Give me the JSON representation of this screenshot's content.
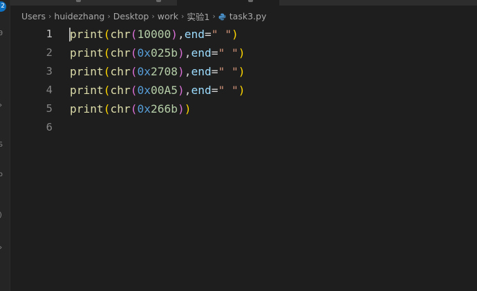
{
  "breadcrumb": {
    "segments": [
      "Users",
      "huidezhang",
      "Desktop",
      "work",
      "实验1"
    ],
    "file": "task3.py",
    "file_icon": "python-icon"
  },
  "sidebar": {
    "badge": "2",
    "glyphs": [
      "0",
      "›",
      "S",
      "o",
      ")",
      "›"
    ]
  },
  "editor": {
    "current_line": 1,
    "line_numbers": [
      "1",
      "2",
      "3",
      "4",
      "5",
      "6"
    ],
    "lines": [
      [
        [
          "fn",
          "print"
        ],
        [
          "p1",
          "("
        ],
        [
          "fn",
          "chr"
        ],
        [
          "p2",
          "("
        ],
        [
          "num",
          "10000"
        ],
        [
          "p2",
          ")"
        ],
        [
          "op",
          ","
        ],
        [
          "kw",
          "end"
        ],
        [
          "op",
          "="
        ],
        [
          "str",
          "\" \""
        ],
        [
          "p1",
          ")"
        ]
      ],
      [
        [
          "fn",
          "print"
        ],
        [
          "p1",
          "("
        ],
        [
          "fn",
          "chr"
        ],
        [
          "p2",
          "("
        ],
        [
          "pre",
          "0x"
        ],
        [
          "num",
          "025b"
        ],
        [
          "p2",
          ")"
        ],
        [
          "op",
          ","
        ],
        [
          "kw",
          "end"
        ],
        [
          "op",
          "="
        ],
        [
          "str",
          "\" \""
        ],
        [
          "p1",
          ")"
        ]
      ],
      [
        [
          "fn",
          "print"
        ],
        [
          "p1",
          "("
        ],
        [
          "fn",
          "chr"
        ],
        [
          "p2",
          "("
        ],
        [
          "pre",
          "0x"
        ],
        [
          "num",
          "2708"
        ],
        [
          "p2",
          ")"
        ],
        [
          "op",
          ","
        ],
        [
          "kw",
          "end"
        ],
        [
          "op",
          "="
        ],
        [
          "str",
          "\" \""
        ],
        [
          "p1",
          ")"
        ]
      ],
      [
        [
          "fn",
          "print"
        ],
        [
          "p1",
          "("
        ],
        [
          "fn",
          "chr"
        ],
        [
          "p2",
          "("
        ],
        [
          "pre",
          "0x"
        ],
        [
          "num",
          "00A5"
        ],
        [
          "p2",
          ")"
        ],
        [
          "op",
          ","
        ],
        [
          "kw",
          "end"
        ],
        [
          "op",
          "="
        ],
        [
          "str",
          "\" \""
        ],
        [
          "p1",
          ")"
        ]
      ],
      [
        [
          "fn",
          "print"
        ],
        [
          "p1",
          "("
        ],
        [
          "fn",
          "chr"
        ],
        [
          "p2",
          "("
        ],
        [
          "pre",
          "0x"
        ],
        [
          "num",
          "266b"
        ],
        [
          "p2",
          ")"
        ],
        [
          "p1",
          ")"
        ]
      ],
      []
    ]
  },
  "colors": {
    "background": "#1e1e1e",
    "function": "#dcdcaa",
    "bracket_level1": "#ffd700",
    "bracket_level2": "#da70d6",
    "number": "#b5cea8",
    "hex_prefix": "#569cd6",
    "keyword_arg": "#9cdcfe",
    "string": "#ce9178"
  }
}
